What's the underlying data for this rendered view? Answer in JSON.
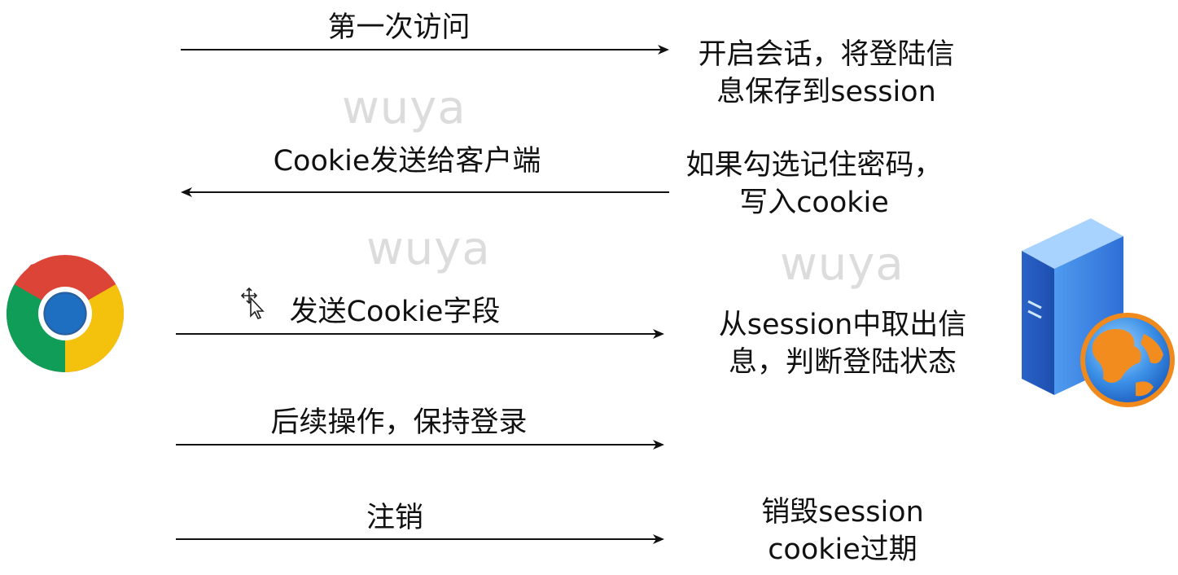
{
  "messages": [
    {
      "label": "第一次访问",
      "direction": "right"
    },
    {
      "label": "Cookie发送给客户端",
      "direction": "left"
    },
    {
      "label": "发送Cookie字段",
      "direction": "right"
    },
    {
      "label": "后续操作，保持登录",
      "direction": "right"
    },
    {
      "label": "注销",
      "direction": "right"
    }
  ],
  "server_notes": [
    {
      "line1": "开启会话，将登陆信",
      "line2": "息保存到session"
    },
    {
      "line1": "如果勾选记住密码，",
      "line2": "写入cookie"
    },
    {
      "line1": "从session中取出信",
      "line2": "息，判断登陆状态"
    },
    {
      "line1": "销毁session",
      "line2": "cookie过期"
    }
  ],
  "watermarks": [
    "wuya",
    "wuya",
    "wuya"
  ],
  "icons": {
    "client": "chrome-browser-icon",
    "server": "server-globe-icon",
    "cursor": "move-cursor-icon"
  },
  "colors": {
    "chrome_red": "#DB4437",
    "chrome_yellow": "#F4C20D",
    "chrome_green": "#0F9D58",
    "chrome_blue": "#4285F4",
    "server_blue": "#3a7fe0",
    "globe_orange": "#f08a1c"
  }
}
